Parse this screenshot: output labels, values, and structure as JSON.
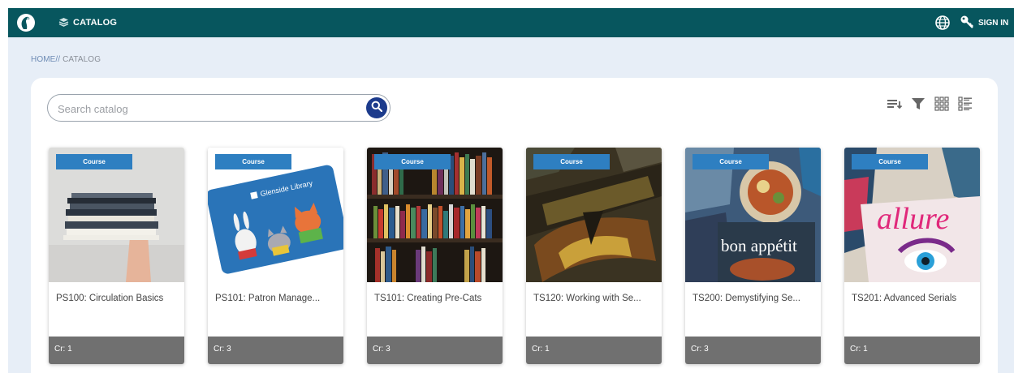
{
  "header": {
    "nav_catalog": "CATALOG",
    "signin": "SIGN IN"
  },
  "breadcrumb": {
    "home": "HOME",
    "separator": "//",
    "current": "CATALOG"
  },
  "search": {
    "placeholder": "Search catalog"
  },
  "toolbar": {
    "icons": [
      "sort-icon",
      "filter-icon",
      "grid-view-icon",
      "list-view-icon"
    ]
  },
  "courses": [
    {
      "badge": "Course",
      "title": "PS100: Circulation Basics",
      "credits": "Cr: 1"
    },
    {
      "badge": "Course",
      "title": "PS101: Patron Manage...",
      "credits": "Cr: 3",
      "card_text": "Glenside Library"
    },
    {
      "badge": "Course",
      "title": "TS101: Creating Pre-Cats",
      "credits": "Cr: 3"
    },
    {
      "badge": "Course",
      "title": "TS120: Working with Se...",
      "credits": "Cr: 1"
    },
    {
      "badge": "Course",
      "title": "TS200: Demystifying Se...",
      "credits": "Cr: 3",
      "magazine_text": "bon appétit"
    },
    {
      "badge": "Course",
      "title": "TS201: Advanced Serials",
      "credits": "Cr: 1",
      "magazine_text": "allure"
    }
  ],
  "colors": {
    "topbar": "#07565e",
    "badge": "#2e7fc1",
    "credits_bar": "#707070",
    "search_button": "#1c3b8c",
    "background": "#e7eef7"
  }
}
